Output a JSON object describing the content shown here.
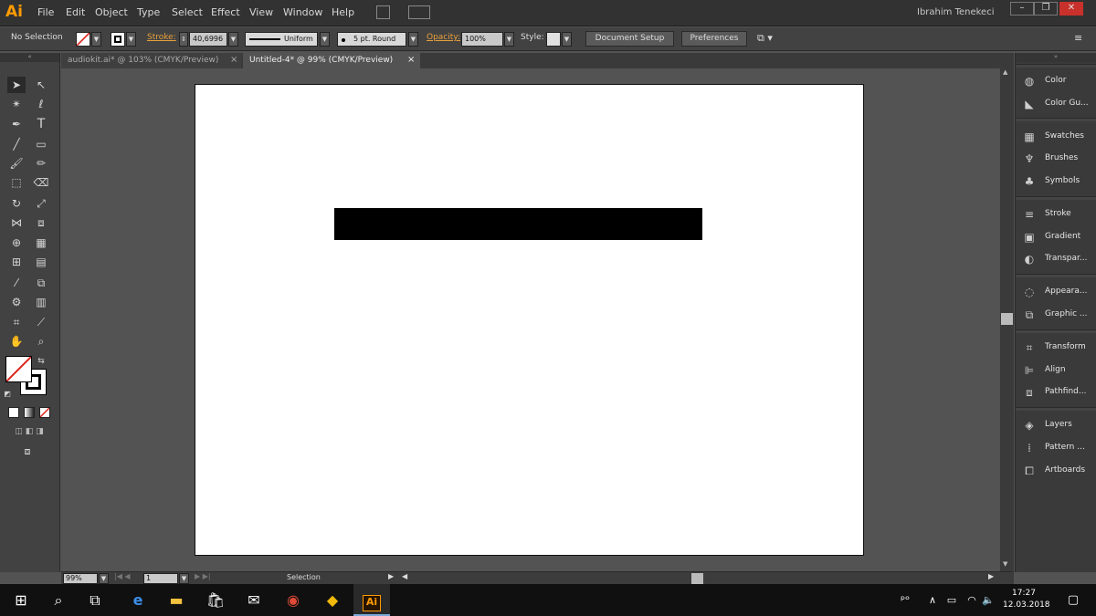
{
  "app": {
    "logo": "Ai",
    "user": "Ibrahim Tenekeci"
  },
  "menu": [
    "File",
    "Edit",
    "Object",
    "Type",
    "Select",
    "Effect",
    "View",
    "Window",
    "Help"
  ],
  "control": {
    "selection": "No Selection",
    "stroke_label": "Stroke:",
    "stroke_value": "40,6996",
    "profile": "Uniform",
    "brush": "5 pt. Round",
    "opacity_label": "Opacity:",
    "opacity_value": "100%",
    "style_label": "Style:",
    "doc_setup": "Document Setup",
    "preferences": "Preferences"
  },
  "tabs": [
    {
      "label": "audiokit.ai* @ 103% (CMYK/Preview)"
    },
    {
      "label": "Untitled-4* @ 99% (CMYK/Preview)"
    }
  ],
  "panels": [
    "Color",
    "Color Gu...",
    "Swatches",
    "Brushes",
    "Symbols",
    "Stroke",
    "Gradient",
    "Transpar...",
    "Appeara...",
    "Graphic ...",
    "Transform",
    "Align",
    "Pathfind...",
    "Layers",
    "Pattern ...",
    "Artboards"
  ],
  "status": {
    "zoom": "99%",
    "artboard": "1",
    "tool": "Selection"
  },
  "clock": {
    "time": "17:27",
    "date": "12.03.2018"
  },
  "colors": {
    "accent": "#ff9a00",
    "link": "#e9a03a",
    "fill_none": "#d9251c"
  }
}
